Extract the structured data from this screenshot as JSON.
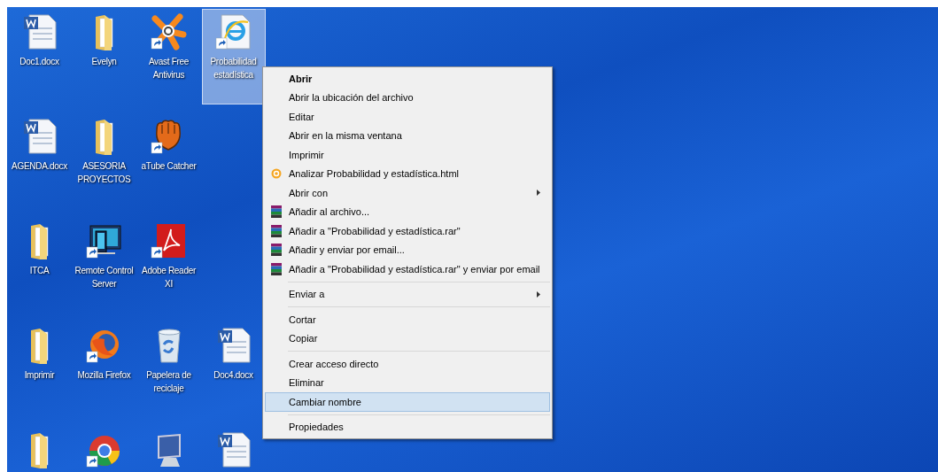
{
  "desktop": {
    "rows": [
      [
        {
          "kind": "word",
          "shortcut": false,
          "selected": false,
          "label": [
            "Doc1.docx"
          ]
        },
        {
          "kind": "folder",
          "shortcut": false,
          "selected": false,
          "label": [
            "Evelyn"
          ]
        },
        {
          "kind": "avast",
          "shortcut": true,
          "selected": false,
          "label": [
            "Avast Free",
            "Antivirus"
          ]
        },
        {
          "kind": "ie",
          "shortcut": true,
          "selected": true,
          "label": [
            "Probabilidad",
            "estadística"
          ]
        }
      ],
      [
        {
          "kind": "word",
          "shortcut": false,
          "selected": false,
          "label": [
            "AGENDA.docx"
          ]
        },
        {
          "kind": "folder",
          "shortcut": false,
          "selected": false,
          "label": [
            "ASESORIA",
            "PROYECTOS"
          ]
        },
        {
          "kind": "atube",
          "shortcut": true,
          "selected": false,
          "label": [
            "aTube Catcher"
          ]
        }
      ],
      [
        {
          "kind": "folder",
          "shortcut": false,
          "selected": false,
          "label": [
            "ITCA"
          ]
        },
        {
          "kind": "remote",
          "shortcut": true,
          "selected": false,
          "label": [
            "Remote Control",
            "Server"
          ]
        },
        {
          "kind": "adobe",
          "shortcut": true,
          "selected": false,
          "label": [
            "Adobe Reader",
            "XI"
          ]
        }
      ],
      [
        {
          "kind": "folder",
          "shortcut": false,
          "selected": false,
          "label": [
            "Imprimir"
          ]
        },
        {
          "kind": "firefox",
          "shortcut": true,
          "selected": false,
          "label": [
            "Mozilla Firefox"
          ]
        },
        {
          "kind": "recycle",
          "shortcut": false,
          "selected": false,
          "label": [
            "Papelera de",
            "reciclaje"
          ]
        },
        {
          "kind": "word",
          "shortcut": false,
          "selected": false,
          "label": [
            "Doc4.docx"
          ]
        }
      ],
      [
        {
          "kind": "folder",
          "shortcut": false,
          "selected": false
        },
        {
          "kind": "chrome",
          "shortcut": true,
          "selected": false
        },
        {
          "kind": "computer",
          "shortcut": false,
          "selected": false
        },
        {
          "kind": "word",
          "shortcut": false,
          "selected": false
        }
      ]
    ]
  },
  "context_menu": {
    "sections": [
      [
        {
          "label": "Abrir",
          "default": true,
          "selected": false,
          "submenu": false
        },
        {
          "label": "Abrir la ubicación del archivo",
          "default": false,
          "selected": false,
          "submenu": false
        },
        {
          "label": "Editar",
          "default": false,
          "selected": false,
          "submenu": false
        },
        {
          "label": "Abrir en la misma ventana",
          "default": false,
          "selected": false,
          "submenu": false
        },
        {
          "label": "Imprimir",
          "default": false,
          "selected": false,
          "submenu": false
        },
        {
          "label": "Analizar Probabilidad y estadística.html",
          "kind": "avast",
          "default": false,
          "selected": false,
          "submenu": false
        },
        {
          "label": "Abrir con",
          "default": false,
          "selected": false,
          "submenu": true
        },
        {
          "label": "Añadir al archivo...",
          "kind": "winrar",
          "default": false,
          "selected": false,
          "submenu": false
        },
        {
          "label": "Añadir a \"Probabilidad y estadística.rar\"",
          "kind": "winrar",
          "default": false,
          "selected": false,
          "submenu": false
        },
        {
          "label": "Añadir y enviar por email...",
          "kind": "winrar",
          "default": false,
          "selected": false,
          "submenu": false
        },
        {
          "label": "Añadir a \"Probabilidad y estadística.rar\" y enviar por email",
          "kind": "winrar",
          "default": false,
          "selected": false,
          "submenu": false
        }
      ],
      [
        {
          "label": "Enviar a",
          "default": false,
          "selected": false,
          "submenu": true
        }
      ],
      [
        {
          "label": "Cortar",
          "default": false,
          "selected": false,
          "submenu": false
        },
        {
          "label": "Copiar",
          "default": false,
          "selected": false,
          "submenu": false
        }
      ],
      [
        {
          "label": "Crear acceso directo",
          "default": false,
          "selected": false,
          "submenu": false
        },
        {
          "label": "Eliminar",
          "default": false,
          "selected": false,
          "submenu": false
        },
        {
          "label": "Cambiar nombre",
          "default": false,
          "selected": true,
          "submenu": false
        }
      ],
      [
        {
          "label": "Propiedades",
          "default": false,
          "selected": false,
          "submenu": false
        }
      ]
    ]
  }
}
